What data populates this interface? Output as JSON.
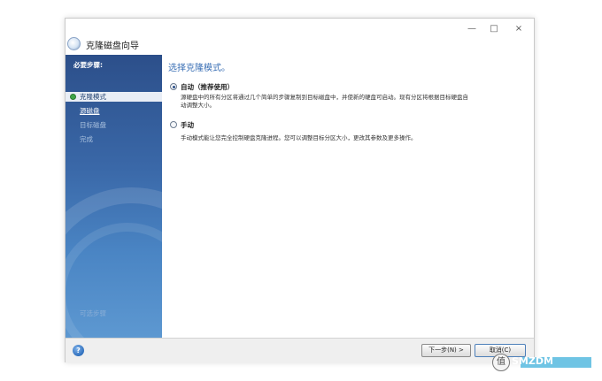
{
  "window": {
    "title": "克隆磁盘向导",
    "controls": {
      "minimize": "—",
      "maximize": "□",
      "close": "×"
    }
  },
  "sidebar": {
    "heading": "必要步骤:",
    "items": [
      {
        "label": "克隆模式",
        "state": "active"
      },
      {
        "label": "源磁盘",
        "state": "link"
      },
      {
        "label": "目标磁盘",
        "state": "dim"
      },
      {
        "label": "完成",
        "state": "dim"
      }
    ],
    "bottom_label": "可选步骤"
  },
  "main": {
    "title": "选择克隆模式。",
    "options": [
      {
        "label": "自动（推荐使用）",
        "checked": true,
        "description_line1": "源硬盘中的所有分区将通过几个简单的步骤复制到目标磁盘中，并使新的硬盘可启动。现有分区将根据目标硬盘自",
        "description_line2": "动调整大小。"
      },
      {
        "label": "手动",
        "checked": false,
        "description_line1": "手动模式能让您完全控制硬盘克隆进程。您可以调整目标分区大小，更改其参数及更多操作。"
      }
    ]
  },
  "footer": {
    "help_glyph": "?",
    "next_label": "下一步(N) >",
    "cancel_label": "取消(C)"
  },
  "watermark": {
    "glyph": "值",
    "text": "SMZDM"
  },
  "colors": {
    "accent": "#3a6fb5",
    "sidebar": "#3a68a8"
  }
}
